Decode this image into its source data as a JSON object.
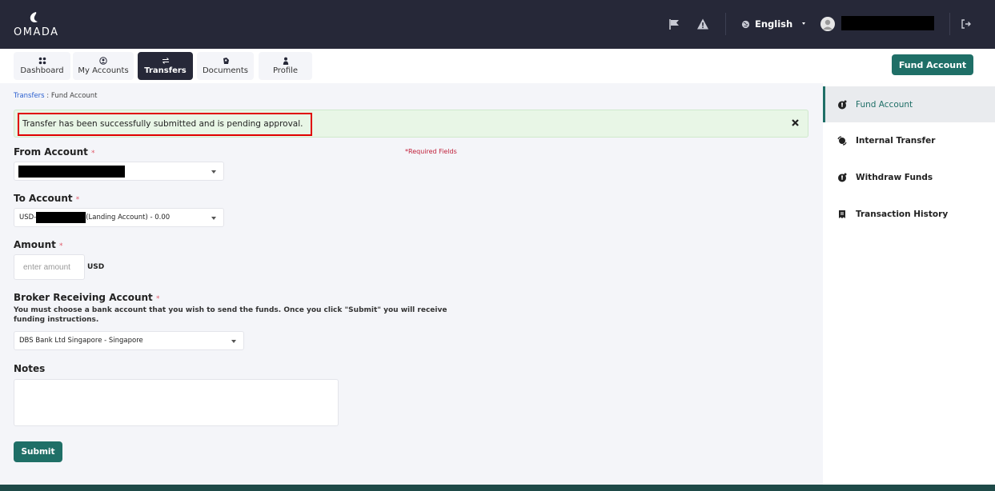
{
  "header": {
    "logo_text": "OMADA",
    "language": "English"
  },
  "nav": {
    "tabs": [
      {
        "label": "Dashboard"
      },
      {
        "label": "My Accounts"
      },
      {
        "label": "Transfers"
      },
      {
        "label": "Documents"
      },
      {
        "label": "Profile"
      }
    ],
    "fund_button": "Fund Account"
  },
  "breadcrumb": {
    "parent": "Transfers",
    "separator": " : ",
    "current": "Fund Account"
  },
  "alert": {
    "message": "Transfer has been successfully submitted and is pending approval."
  },
  "form": {
    "required_fields_note": "*Required Fields",
    "required_mark": "*",
    "from_account": {
      "label": "From Account"
    },
    "to_account": {
      "label": "To Account",
      "value_prefix": "USD-",
      "value_suffix": "(Landing Account) - 0.00"
    },
    "amount": {
      "label": "Amount",
      "placeholder": "enter amount",
      "currency": "USD"
    },
    "broker": {
      "label": "Broker Receiving Account",
      "help": "You must choose a bank account that you wish to send the funds. Once you click \"Submit\" you will receive funding instructions.",
      "value": "DBS Bank Ltd Singapore - Singapore"
    },
    "notes": {
      "label": "Notes"
    },
    "submit_label": "Submit"
  },
  "sidebar": {
    "items": [
      {
        "label": "Fund Account",
        "icon": "coin-icon"
      },
      {
        "label": "Internal Transfer",
        "icon": "exchange-icon"
      },
      {
        "label": "Withdraw Funds",
        "icon": "coin-icon"
      },
      {
        "label": "Transaction History",
        "icon": "receipt-icon"
      }
    ]
  },
  "colors": {
    "topbar": "#262838",
    "accent": "#1f6f67",
    "alert_bg": "#e8f6e6",
    "highlight_border": "#e00000"
  }
}
